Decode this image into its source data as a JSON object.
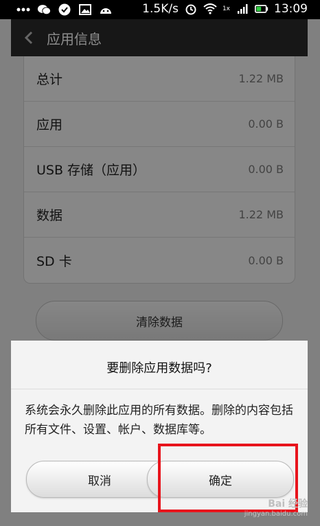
{
  "status_bar": {
    "speed": "1.5K/s",
    "time": "13:09",
    "network_badge": "1x"
  },
  "app_bar": {
    "title": "应用信息"
  },
  "storage": {
    "items": [
      {
        "label": "总计",
        "value": "1.22 MB"
      },
      {
        "label": "应用",
        "value": "0.00 B"
      },
      {
        "label": "USB 存储（应用）",
        "value": "0.00 B"
      },
      {
        "label": "数据",
        "value": "1.22 MB"
      },
      {
        "label": "SD 卡",
        "value": "0.00 B"
      }
    ],
    "clear_button": "清除数据"
  },
  "dialog": {
    "title": "要删除应用数据吗?",
    "message": "系统会永久删除此应用的所有数据。删除的内容包括所有文件、设置、帐户、数据库等。",
    "cancel_label": "取消",
    "confirm_label": "确定"
  },
  "watermark": {
    "logo": "Bai 经验",
    "url": "jingyan.baidu.com"
  },
  "colors": {
    "highlight": "#e8141c",
    "app_bar": "#2a2a2a"
  }
}
